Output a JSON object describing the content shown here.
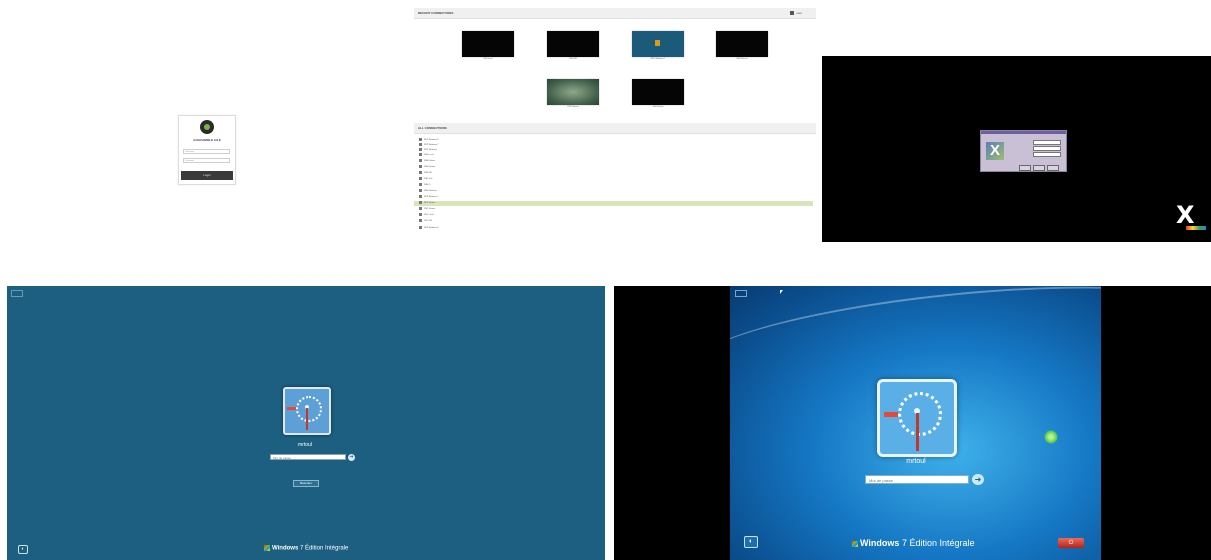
{
  "login": {
    "title": "GUACAMOLE 0.9.8",
    "username_placeholder": "Username",
    "password_placeholder": "Password",
    "login_label": "Login"
  },
  "home": {
    "recent_header": "RECENT CONNECTIONS",
    "user_menu": "user",
    "recent": [
      {
        "label": "SSH Local"
      },
      {
        "label": "SSH VM"
      },
      {
        "label": "RDP Windows 7"
      },
      {
        "label": "SSH Ubuntu"
      },
      {
        "label": "RDP Ubuntu"
      },
      {
        "label": "SSH Debian"
      }
    ],
    "all_header": "ALL CONNECTIONS",
    "connections": [
      "RDP Windows 8",
      "RDP Windows 7",
      "RDP Windows",
      "SSH Local",
      "SSH Debian",
      "SSH Ubuntu",
      "SSH VM",
      "SSH Test",
      "SSH Pi",
      "SSH Windows",
      "RDP Windows 7",
      "RDP Ubuntu",
      "VNC Ubuntu",
      "VNC Local",
      "VNC VM",
      "RDP Windows 8"
    ]
  },
  "windows_teal": {
    "username": "mrtoul",
    "password_placeholder": "Mot de passe",
    "switch_user": "Basculer",
    "brand_main": "Windows",
    "brand_version": "7",
    "brand_edition": "Édition Intégrale"
  },
  "windows_blue": {
    "username": "mrtoul",
    "password_placeholder": "Mot de passe",
    "brand_main": "Windows",
    "brand_version": "7",
    "brand_edition": "Édition Intégrale",
    "icons": {
      "ease": "ease-of-access-icon",
      "go": "arrow-right-icon",
      "power": "power-icon"
    }
  }
}
